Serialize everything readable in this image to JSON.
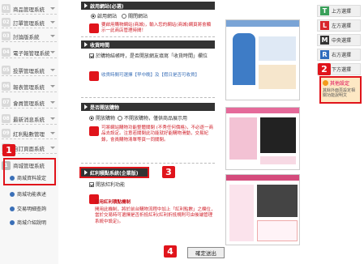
{
  "sidebar": {
    "items": [
      {
        "num": "01",
        "label": "商品管理系統"
      },
      {
        "num": "02",
        "label": "訂單管理系統"
      },
      {
        "num": "03",
        "label": "討論版系統"
      },
      {
        "num": "04",
        "label": "電子報管理系統"
      },
      {
        "num": "05",
        "label": "投票管理系統"
      },
      {
        "num": "06",
        "label": "報表管理系統"
      },
      {
        "num": "07",
        "label": "會員管理系統"
      },
      {
        "num": "08",
        "label": "最新消息系統"
      },
      {
        "num": "09",
        "label": "紅利點數管理"
      },
      {
        "num": "10",
        "label": "自訂頁面系統"
      }
    ],
    "sub_header": "商城管理系統",
    "sub_items": [
      "商城資料設定",
      "商城功能表述",
      "交易明細查詢",
      "商城介紹說明"
    ]
  },
  "callouts": {
    "c1": "1",
    "c2": "2",
    "c3": "3",
    "c4": "4"
  },
  "section1": {
    "title": "啟用網站(必選)",
    "opt_on": "啟用網站",
    "opt_off": "關閉網站",
    "note": "要啟用購物網站(商城)，輸入您的網站(商城)網頁將會顯示一此商店管理時間！"
  },
  "section2": {
    "title": "收貨時間",
    "checkbox": "於購物結帳時，是否開放網友填寫「收貨時間」欄位",
    "note": "收貨時間可選擇【早中晚】及【假日是否可收貨】"
  },
  "section3": {
    "title": "是否開放購物",
    "opt_on": "開放購物",
    "opt_off": "不開放購物，僅供商品展示用",
    "note": "可將網站購物功能整體關閉 (不秀任何價格)，不必逐一商品去設定。注意若關閉此功能就好能購物滑動，交易紀錄，會員購物清單等頁一同關閉。"
  },
  "section4": {
    "title": "紅利積點系統(企業版)",
    "checkbox": "開放紅利功能",
    "note_title": "開用紅利積點機制",
    "note": "開用此機制，將於前台購物流程中加上「紅利點數」之欄位，當於交易時可選擇是否折抵紅利(紅利折抵規則可由後端管理系統中設定)。"
  },
  "right": {
    "items": [
      {
        "letter": "T",
        "label": "上方選擇"
      },
      {
        "letter": "L",
        "label": "左方選擇"
      },
      {
        "letter": "M",
        "label": "中央選擇"
      },
      {
        "letter": "R",
        "label": "右方選擇"
      },
      {
        "letter": "B",
        "label": "下方選擇"
      }
    ],
    "promo_title": "其他設定",
    "promo_text": "其餘外面頁設定相關功能說明文"
  },
  "save_button": "確定送出",
  "colors": {
    "accent": "#e0141b",
    "bar": "#333333",
    "link": "#3a6fb7"
  }
}
